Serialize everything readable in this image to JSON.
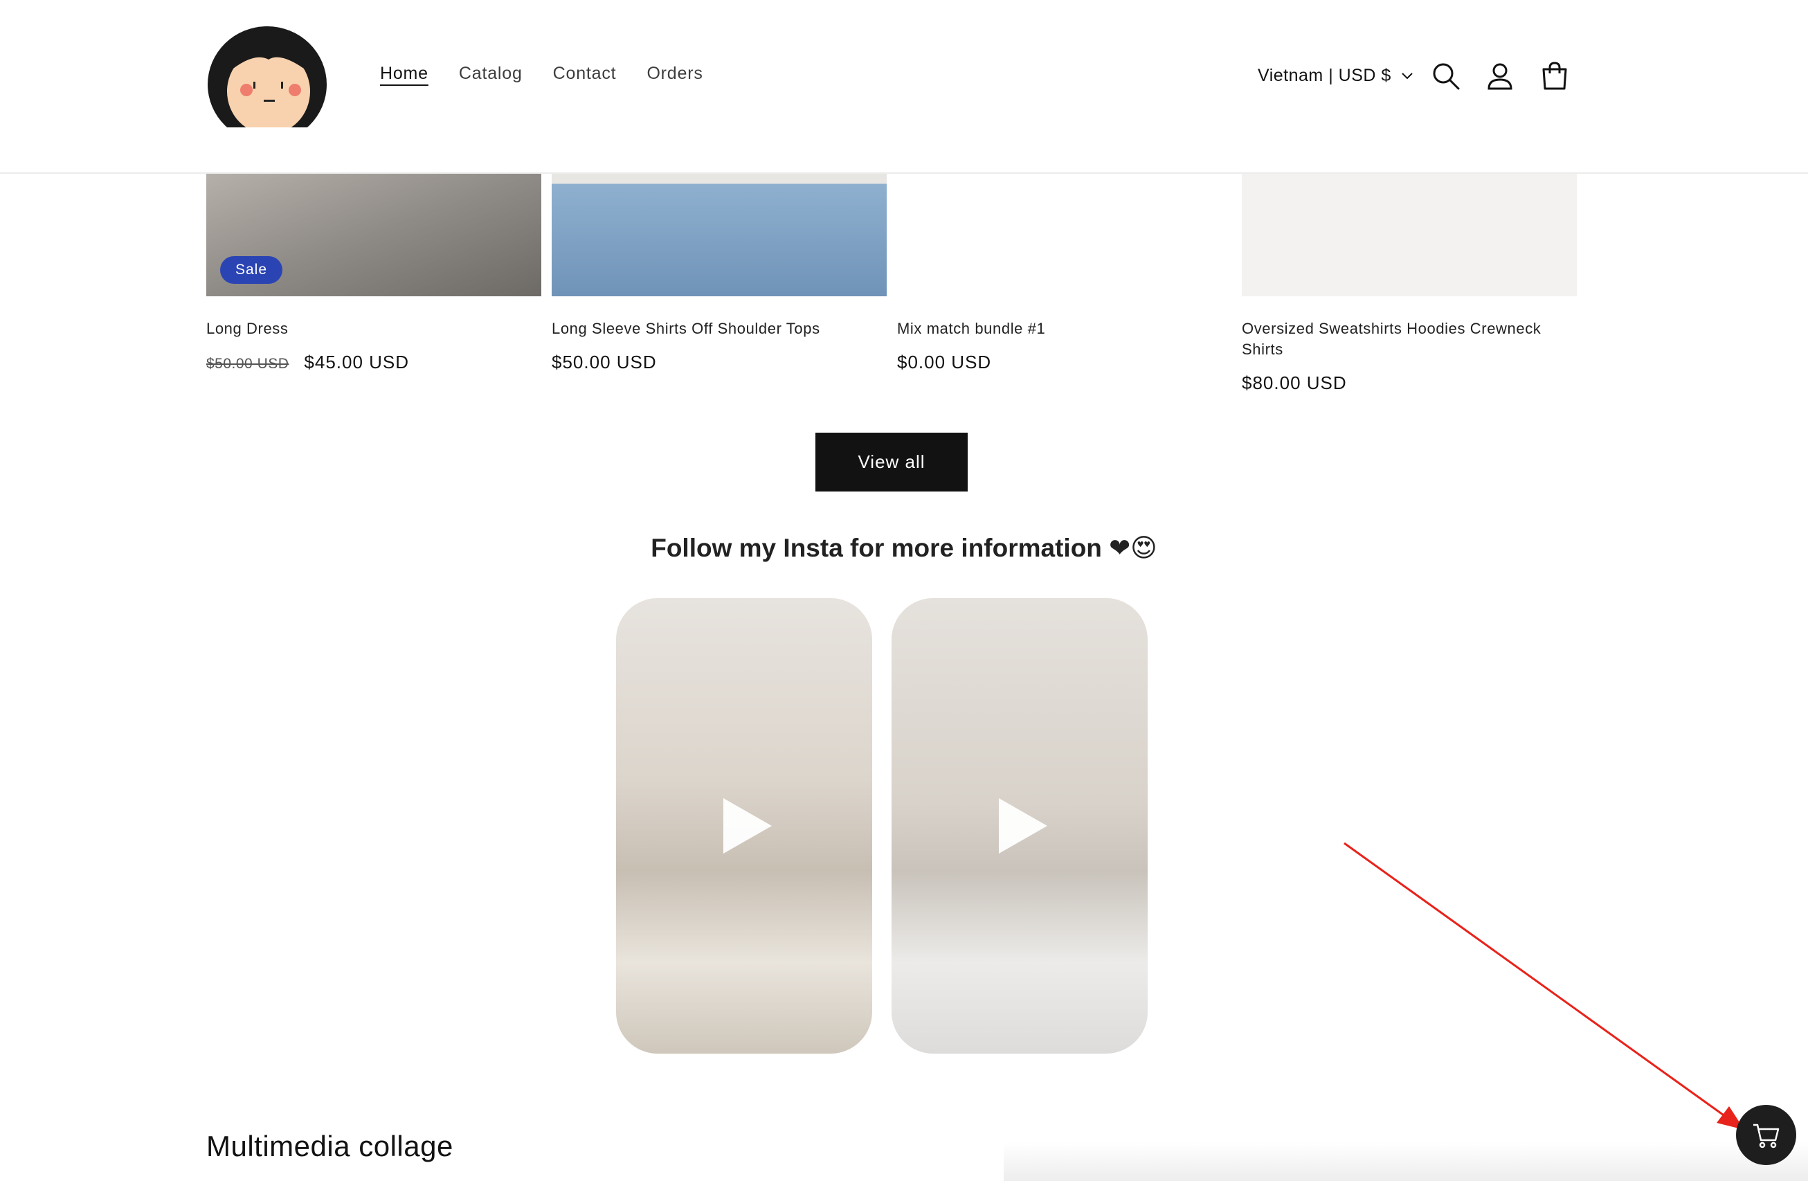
{
  "header": {
    "nav": [
      "Home",
      "Catalog",
      "Contact",
      "Orders"
    ],
    "locale": "Vietnam | USD $"
  },
  "products": [
    {
      "title": "Long Dress",
      "old_price": "$50.00 USD",
      "price": "$45.00 USD",
      "badge": "Sale"
    },
    {
      "title": "Long Sleeve Shirts Off Shoulder Tops",
      "price": "$50.00 USD"
    },
    {
      "title": "Mix match bundle #1",
      "price": "$0.00 USD"
    },
    {
      "title": "Oversized Sweatshirts Hoodies Crewneck Shirts",
      "price": "$80.00 USD"
    }
  ],
  "view_all": "View all",
  "insta": {
    "title": "Follow my Insta for more information ❤😍"
  },
  "collage_title": "Multimedia collage",
  "colors": {
    "sale_badge": "#2b44b3",
    "button_dark": "#121212",
    "annotation_arrow": "#e8231b"
  }
}
